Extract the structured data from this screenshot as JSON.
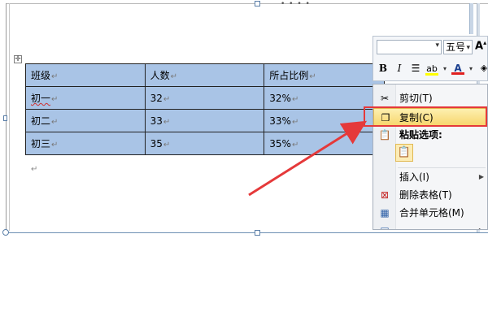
{
  "table": {
    "header": [
      "班级",
      "人数",
      "所占比例"
    ],
    "rows": [
      [
        "初一",
        "32",
        "32%"
      ],
      [
        "初二",
        "33",
        "33%"
      ],
      [
        "初三",
        "35",
        "35%"
      ]
    ],
    "cell_mark": "↵",
    "move_handle": "✛"
  },
  "paragraph_mark": "↵",
  "mini_toolbar": {
    "font_name": "",
    "font_size": "五号",
    "grow_font": "A",
    "bold": "B",
    "italic": "I",
    "highlight_color": "#ffff00",
    "font_color": "#e02020"
  },
  "context_menu": {
    "items": {
      "cut": "剪切(T)",
      "copy": "复制(C)",
      "paste_options": "粘贴选项:",
      "insert": "插入(I)",
      "delete_table": "删除表格(T)",
      "merge_cells": "合并单元格(M)"
    }
  },
  "annotation": {
    "color": "#e5393a"
  }
}
